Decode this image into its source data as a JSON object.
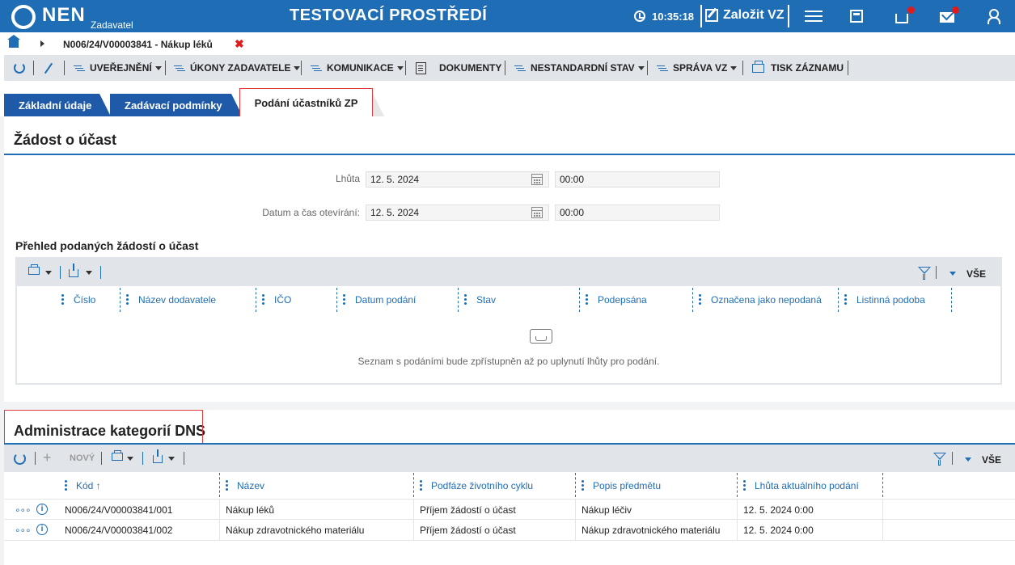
{
  "header": {
    "logo": "NEN",
    "role": "Zadavatel",
    "environment": "TESTOVACÍ PROSTŘEDÍ",
    "time": "10:35:18",
    "create_label": "Založit VZ"
  },
  "breadcrumb": {
    "text": "N006/24/V00003841 - Nákup léků",
    "close": "✖"
  },
  "toolbar": {
    "uverejneni": "UVEŘEJNĚNÍ",
    "ukony": "ÚKONY ZADAVATELE",
    "komunikace": "KOMUNIKACE",
    "dokumenty": "DOKUMENTY",
    "nestandardni": "NESTANDARDNÍ STAV",
    "sprava": "SPRÁVA VZ",
    "tisk": "TISK ZÁZNAMU"
  },
  "tabs": {
    "zakladni": "Základní údaje",
    "zadavaci": "Zadávací podmínky",
    "podani": "Podání účastníků ZP"
  },
  "zadost": {
    "title": "Žádost o účast",
    "lhuta_label": "Lhůta",
    "lhuta_date": "12. 5. 2024",
    "lhuta_time": "00:00",
    "otevirani_label": "Datum a čas otevírání:",
    "otevirani_date": "12. 5. 2024",
    "otevirani_time": "00:00"
  },
  "prehled": {
    "title": "Přehled podaných žádostí o účast",
    "all": "VŠE",
    "columns": [
      "Číslo",
      "Název dodavatele",
      "IČO",
      "Datum podání",
      "Stav",
      "Podepsána",
      "Označena jako nepodaná",
      "Listinná podoba"
    ],
    "empty": "Seznam s podáními bude zpřístupněn až po uplynutí lhůty pro podání."
  },
  "dns": {
    "title": "Administrace kategorií DNS",
    "new": "NOVÝ",
    "all": "VŠE",
    "columns": [
      "Kód ↑",
      "Název",
      "Podfáze životního cyklu",
      "Popis předmětu",
      "Lhůta aktuálního podání"
    ],
    "rows": [
      [
        "N006/24/V00003841/001",
        "Nákup léků",
        "Příjem žádostí o účast",
        "Nákup léčiv",
        "12. 5. 2024 0:00"
      ],
      [
        "N006/24/V00003841/002",
        "Nákup zdravotnického materiálu",
        "Příjem žádostí o účast",
        "Nákup zdravotnického materiálu",
        "12. 5. 2024 0:00"
      ]
    ]
  }
}
